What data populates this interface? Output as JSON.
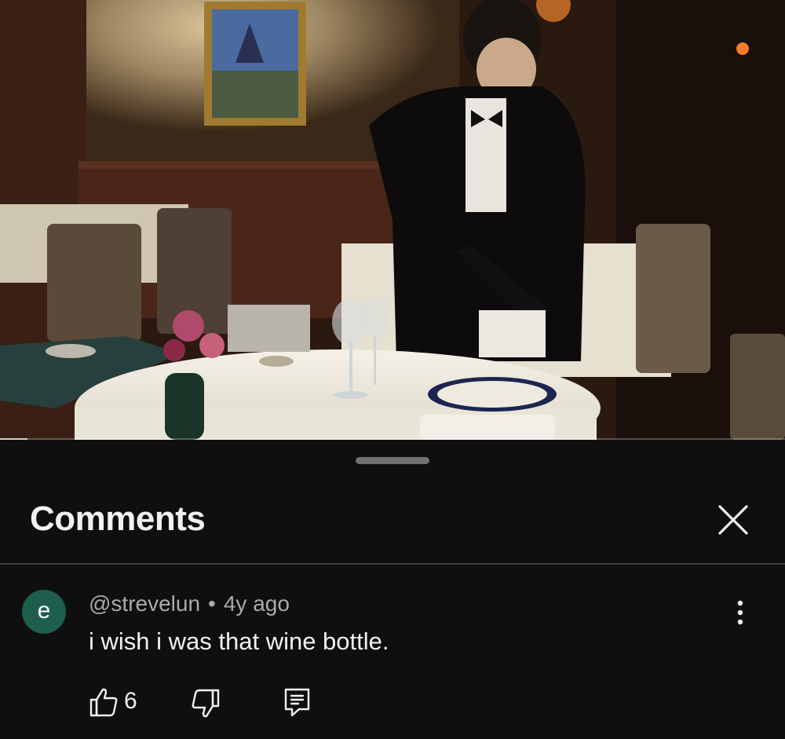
{
  "video": {
    "progress_fraction": 0.035
  },
  "comments_panel": {
    "title": "Comments"
  },
  "comment": {
    "avatar_letter": "e",
    "avatar_color": "#1d5e4d",
    "author": "@strevelun",
    "separator": "•",
    "age": "4y ago",
    "text": "i wish i was that wine bottle.",
    "like_count": "6"
  },
  "icons": {
    "close": "close-icon",
    "more": "more-vertical-icon",
    "like": "thumbs-up-icon",
    "dislike": "thumbs-down-icon",
    "reply": "reply-icon"
  }
}
